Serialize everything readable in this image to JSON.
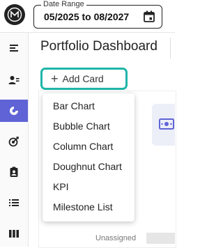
{
  "header": {
    "date_range": {
      "legend": "Date Range",
      "value": "05/2025 to 08/2027"
    }
  },
  "page": {
    "title": "Portfolio Dashboard"
  },
  "add_card": {
    "label": "Add Card"
  },
  "menu": {
    "items": [
      {
        "label": "Bar Chart"
      },
      {
        "label": "Bubble Chart"
      },
      {
        "label": "Column Chart"
      },
      {
        "label": "Doughnut Chart"
      },
      {
        "label": "KPI"
      },
      {
        "label": "Milestone List"
      }
    ]
  },
  "content": {
    "unassigned_label": "Unassigned"
  },
  "colors": {
    "accent": "#5f63d6",
    "highlight": "#1fb5a8"
  }
}
